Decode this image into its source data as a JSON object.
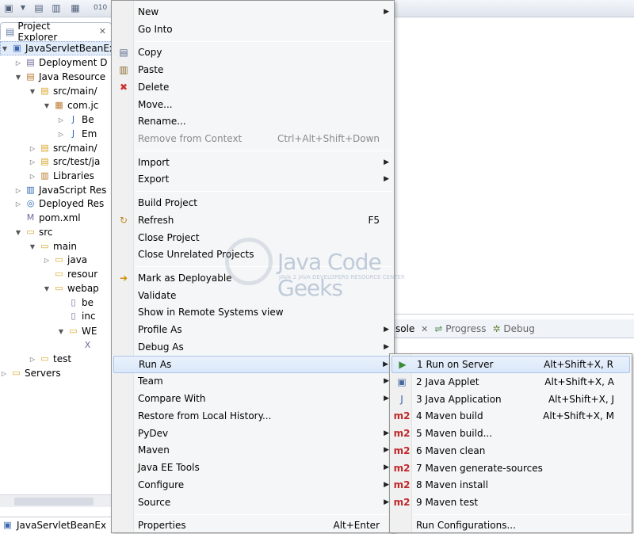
{
  "toolbar": {
    "icons": [
      "new-icon",
      "save-icon",
      "save-all-icon",
      "print-icon",
      "binary-icon"
    ]
  },
  "explorer": {
    "tab_label": "Project Explorer",
    "close_glyph": "✕",
    "tree": [
      {
        "label": "JavaServletBeanEx",
        "icon": "project-icon"
      },
      {
        "label": "Deployment D",
        "icon": "deployment-descriptor-icon"
      },
      {
        "label": "Java Resource",
        "icon": "java-resources-icon"
      },
      {
        "label": "src/main/",
        "icon": "source-folder-icon"
      },
      {
        "label": "com.jc",
        "icon": "package-icon"
      },
      {
        "label": "Be",
        "icon": "java-file-icon"
      },
      {
        "label": "Em",
        "icon": "java-file-icon"
      },
      {
        "label": "src/main/",
        "icon": "source-folder-icon"
      },
      {
        "label": "src/test/ja",
        "icon": "source-folder-icon"
      },
      {
        "label": "Libraries",
        "icon": "libraries-icon"
      },
      {
        "label": "JavaScript Res",
        "icon": "javascript-resources-icon"
      },
      {
        "label": "Deployed Res",
        "icon": "deployed-resources-icon"
      },
      {
        "label": "pom.xml",
        "icon": "maven-pom-icon"
      },
      {
        "label": "src",
        "icon": "folder-icon"
      },
      {
        "label": "main",
        "icon": "folder-icon"
      },
      {
        "label": "java",
        "icon": "folder-icon"
      },
      {
        "label": "resour",
        "icon": "folder-icon"
      },
      {
        "label": "webap",
        "icon": "folder-icon"
      },
      {
        "label": "be",
        "icon": "jsp-file-icon"
      },
      {
        "label": "inc",
        "icon": "jsp-file-icon"
      },
      {
        "label": "WE",
        "icon": "folder-icon"
      },
      {
        "label": "",
        "icon": "xml-file-icon"
      },
      {
        "label": "test",
        "icon": "folder-icon"
      },
      {
        "label": "Servers",
        "icon": "folder-icon"
      }
    ]
  },
  "bottom_panel": {
    "tabs": [
      "sole",
      "Progress",
      "Debug"
    ]
  },
  "status": {
    "project_label": "JavaServletBeanEx"
  },
  "context_menu": {
    "items": [
      {
        "label": "New",
        "submenu": true
      },
      {
        "label": "Go Into"
      },
      {
        "label": "Copy",
        "icon": "copy-icon"
      },
      {
        "label": "Paste",
        "icon": "paste-icon"
      },
      {
        "label": "Delete",
        "icon": "delete-icon"
      },
      {
        "label": "Move..."
      },
      {
        "label": "Rename..."
      },
      {
        "label": "Remove from Context",
        "accel": "Ctrl+Alt+Shift+Down",
        "disabled": true
      },
      {
        "label": "Import",
        "submenu": true
      },
      {
        "label": "Export",
        "submenu": true
      },
      {
        "label": "Build Project"
      },
      {
        "label": "Refresh",
        "accel": "F5",
        "icon": "refresh-icon"
      },
      {
        "label": "Close Project"
      },
      {
        "label": "Close Unrelated Projects"
      },
      {
        "label": "Mark as Deployable",
        "icon": "deploy-icon"
      },
      {
        "label": "Validate"
      },
      {
        "label": "Show in Remote Systems view"
      },
      {
        "label": "Profile As",
        "submenu": true
      },
      {
        "label": "Debug As",
        "submenu": true
      },
      {
        "label": "Run As",
        "submenu": true,
        "hover": true
      },
      {
        "label": "Team",
        "submenu": true
      },
      {
        "label": "Compare With",
        "submenu": true
      },
      {
        "label": "Restore from Local History..."
      },
      {
        "label": "PyDev",
        "submenu": true
      },
      {
        "label": "Maven",
        "submenu": true
      },
      {
        "label": "Java EE Tools",
        "submenu": true
      },
      {
        "label": "Configure",
        "submenu": true
      },
      {
        "label": "Source",
        "submenu": true
      },
      {
        "label": "Properties",
        "accel": "Alt+Enter"
      }
    ]
  },
  "run_as_menu": {
    "items": [
      {
        "label": "1 Run on Server",
        "accel": "Alt+Shift+X, R",
        "icon": "run-on-server-icon",
        "hover": true
      },
      {
        "label": "2 Java Applet",
        "accel": "Alt+Shift+X, A",
        "icon": "java-applet-icon"
      },
      {
        "label": "3 Java Application",
        "accel": "Alt+Shift+X, J",
        "icon": "java-application-icon"
      },
      {
        "label": "4 Maven build",
        "accel": "Alt+Shift+X, M",
        "icon": "maven-icon"
      },
      {
        "label": "5 Maven build...",
        "icon": "maven-icon"
      },
      {
        "label": "6 Maven clean",
        "icon": "maven-icon"
      },
      {
        "label": "7 Maven generate-sources",
        "icon": "maven-icon"
      },
      {
        "label": "8 Maven install",
        "icon": "maven-icon"
      },
      {
        "label": "9 Maven test",
        "icon": "maven-icon"
      },
      {
        "label": "Run Configurations..."
      }
    ],
    "maven_glyph": "m2"
  },
  "watermark": {
    "title": "Java Code Geeks",
    "subtitle": "JAVA 2 JAVA DEVELOPERS RESOURCE CENTER",
    "logo_text": "jcg"
  }
}
